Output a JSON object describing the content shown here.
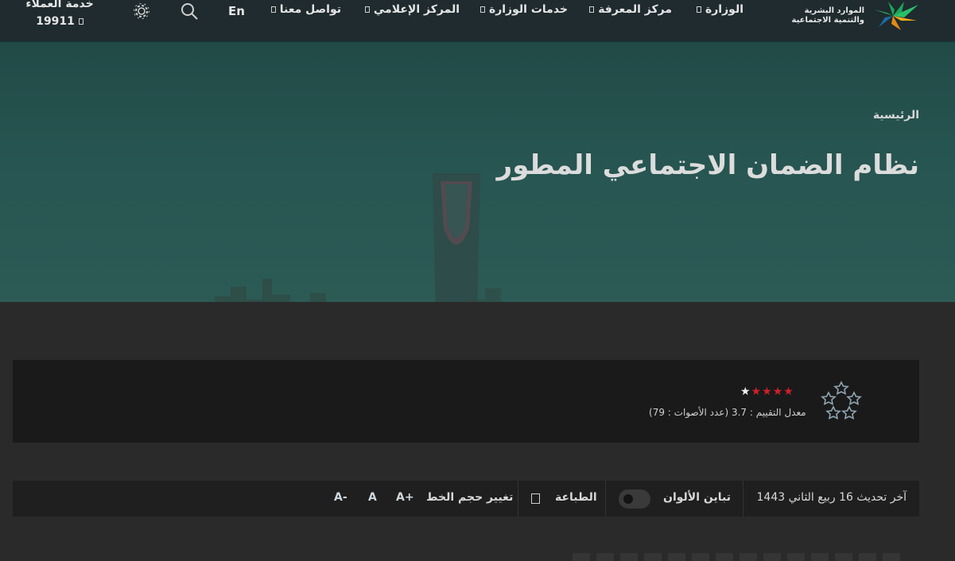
{
  "header": {
    "logo_line1": "الموارد البشرية",
    "logo_line2": "والتنمية الاجتماعية",
    "nav": [
      {
        "label": "الوزارة"
      },
      {
        "label": "مركز المعرفة"
      },
      {
        "label": "خدمات الوزارة"
      },
      {
        "label": "المركز الإعلامي"
      },
      {
        "label": "تواصل معنا"
      }
    ],
    "lang_label": "En",
    "customer_service_label": "خدمة العملاء",
    "customer_service_number": "19911",
    "icons": {
      "search": "search-icon",
      "settings": "gear-icon"
    }
  },
  "hero": {
    "breadcrumb": "الرئيسية",
    "title": "نظام الضمان الاجتماعي المطور"
  },
  "rating": {
    "stars_red": 4,
    "stars_total": 5,
    "summary": "معدل التقييم : 3.7 (عدد الأصوات : 79)"
  },
  "toolbar": {
    "last_update": "آخر تحديث 16 ربيع الثاني 1443",
    "contrast_label": "تباين الألوان",
    "print_label": "الطباعة",
    "font_size_label": "تغيير حجم الخط",
    "font_increase": "A+",
    "font_normal": "A",
    "font_decrease": "A-"
  },
  "colors": {
    "header_bg": "#1f2b2e",
    "hero_bg": "#275551",
    "star_red": "#d0202a"
  }
}
